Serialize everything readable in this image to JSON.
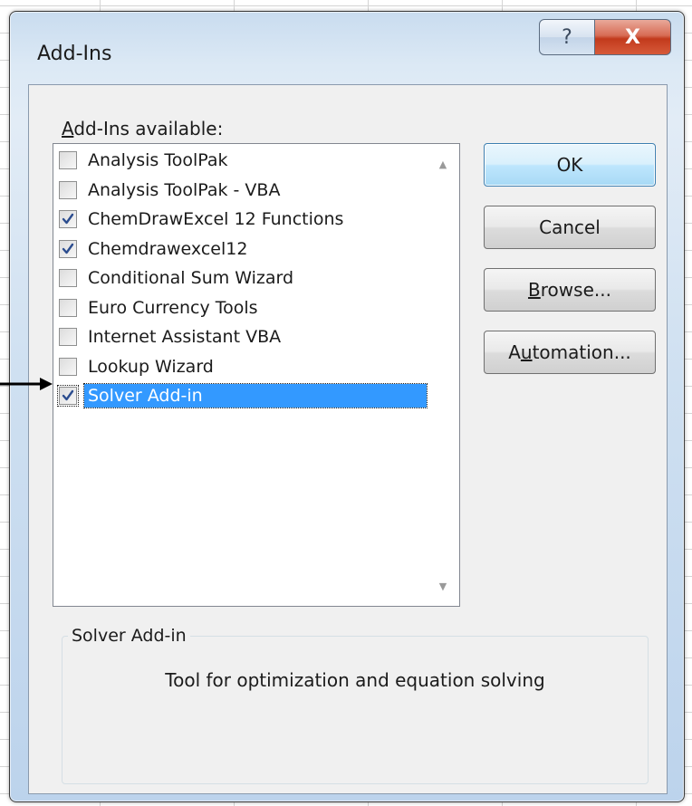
{
  "dialog": {
    "title": "Add-Ins",
    "help_glyph": "?",
    "close_glyph": "X"
  },
  "list": {
    "label_prefix": "",
    "label_accel": "A",
    "label_rest": "dd-Ins available:",
    "items": [
      {
        "label": "Analysis ToolPak",
        "checked": false
      },
      {
        "label": "Analysis ToolPak - VBA",
        "checked": false
      },
      {
        "label": "ChemDrawExcel 12 Functions",
        "checked": true
      },
      {
        "label": "Chemdrawexcel12",
        "checked": true
      },
      {
        "label": "Conditional Sum Wizard",
        "checked": false
      },
      {
        "label": "Euro Currency Tools",
        "checked": false
      },
      {
        "label": "Internet Assistant VBA",
        "checked": false
      },
      {
        "label": "Lookup Wizard",
        "checked": false
      },
      {
        "label": "Solver Add-in",
        "checked": true,
        "selected": true
      }
    ]
  },
  "buttons": {
    "ok": "OK",
    "cancel": "Cancel",
    "browse_accel": "B",
    "browse_rest": "rowse...",
    "automation_pre": "A",
    "automation_accel": "u",
    "automation_rest": "tomation..."
  },
  "description": {
    "group_title": "Solver Add-in",
    "text": "Tool for optimization and equation solving"
  },
  "colors": {
    "selection": "#3399ff",
    "check": "#2c4d8f",
    "close": "#c23a1c"
  }
}
